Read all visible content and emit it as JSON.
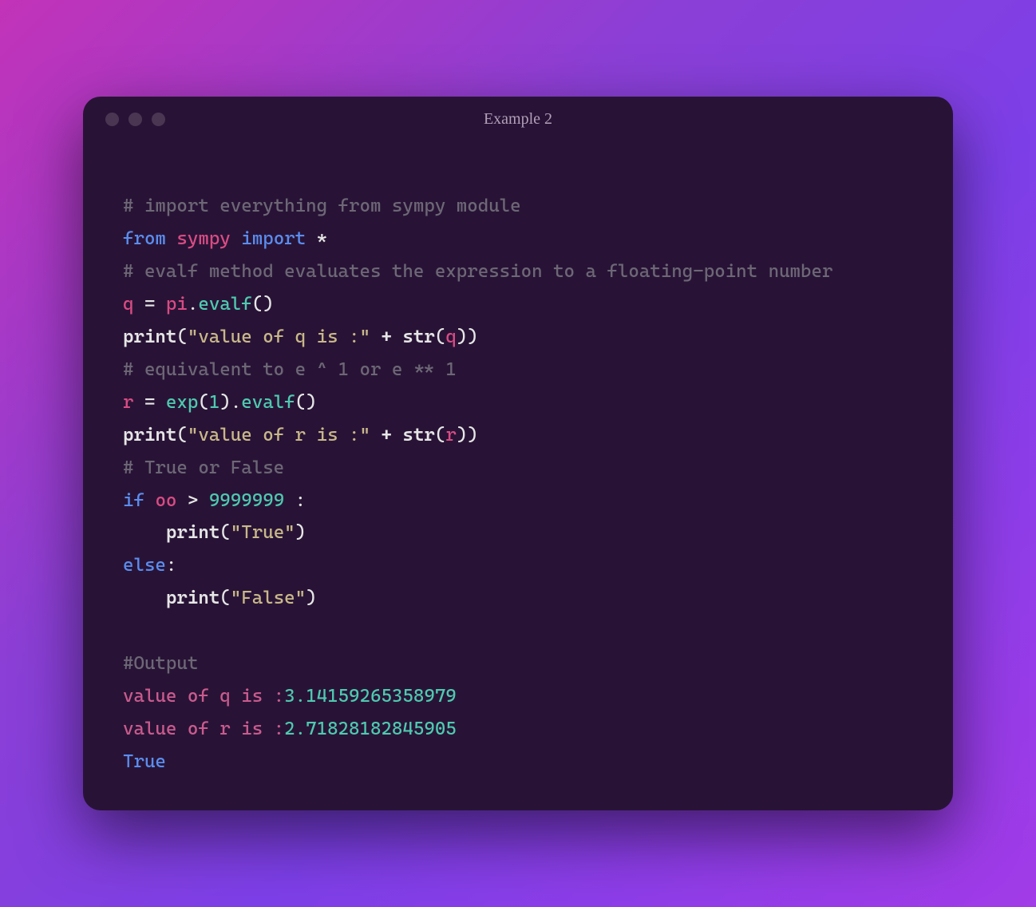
{
  "window": {
    "title": "Example 2"
  },
  "code": {
    "c1": "# import everything from sympy module",
    "kw_from": "from",
    "mod_sympy": "sympy",
    "kw_import": "import",
    "star": "*",
    "c2": "# evalf method evaluates the expression to a floating-point number",
    "var_q": "q",
    "eq": " = ",
    "pi": "pi",
    "dot": ".",
    "evalf": "evalf",
    "parens": "()",
    "print": "print",
    "lp": "(",
    "rp": ")",
    "str_q": "\"value of q is :\"",
    "plus": " + ",
    "str_fn": "str",
    "c3": "# equivalent to e ^ 1 or e ** 1",
    "var_r": "r",
    "exp": "exp",
    "one": "1",
    "str_r": "\"value of r is :\"",
    "c4": "# True or False",
    "kw_if": "if",
    "oo": "oo",
    "gt": " > ",
    "bignum": "9999999",
    "colon": " :",
    "colon2": ":",
    "indent": "    ",
    "str_true": "\"True\"",
    "kw_else": "else",
    "str_false": "\"False\"",
    "c_out": "#Output",
    "out_q_label": "value of q is :",
    "out_q_val": "3.14159265358979",
    "out_r_label": "value of r is :",
    "out_r_val": "2.71828182845905",
    "out_true": "True"
  }
}
